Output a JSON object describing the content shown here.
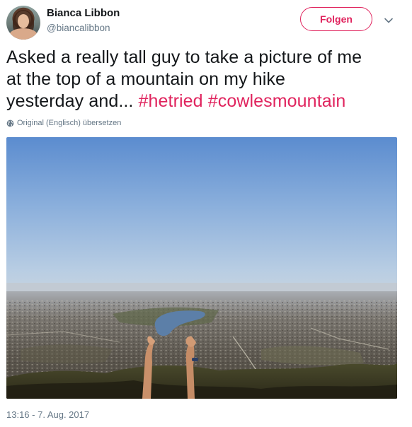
{
  "user": {
    "name": "Bianca Libbon",
    "handle": "@biancalibbon",
    "avatar_icon": "profile-photo"
  },
  "follow_button": {
    "label": "Folgen",
    "color": "#e0245e"
  },
  "menu": {
    "icon": "chevron-down-icon"
  },
  "tweet": {
    "text_line1": "Asked a really tall guy to take a picture of me",
    "text_line2": "at the top of a mountain on my hike",
    "text_line3": "yesterday and... ",
    "hashtags": [
      "#hetried",
      "#cowlesmountain"
    ],
    "hashtag_color": "#e0245e"
  },
  "translate": {
    "label": "Original (Englisch) übersetzen",
    "icon": "globe-icon"
  },
  "media": {
    "description_icon": "landscape-photo"
  },
  "timestamp": "13:16 - 7. Aug. 2017"
}
